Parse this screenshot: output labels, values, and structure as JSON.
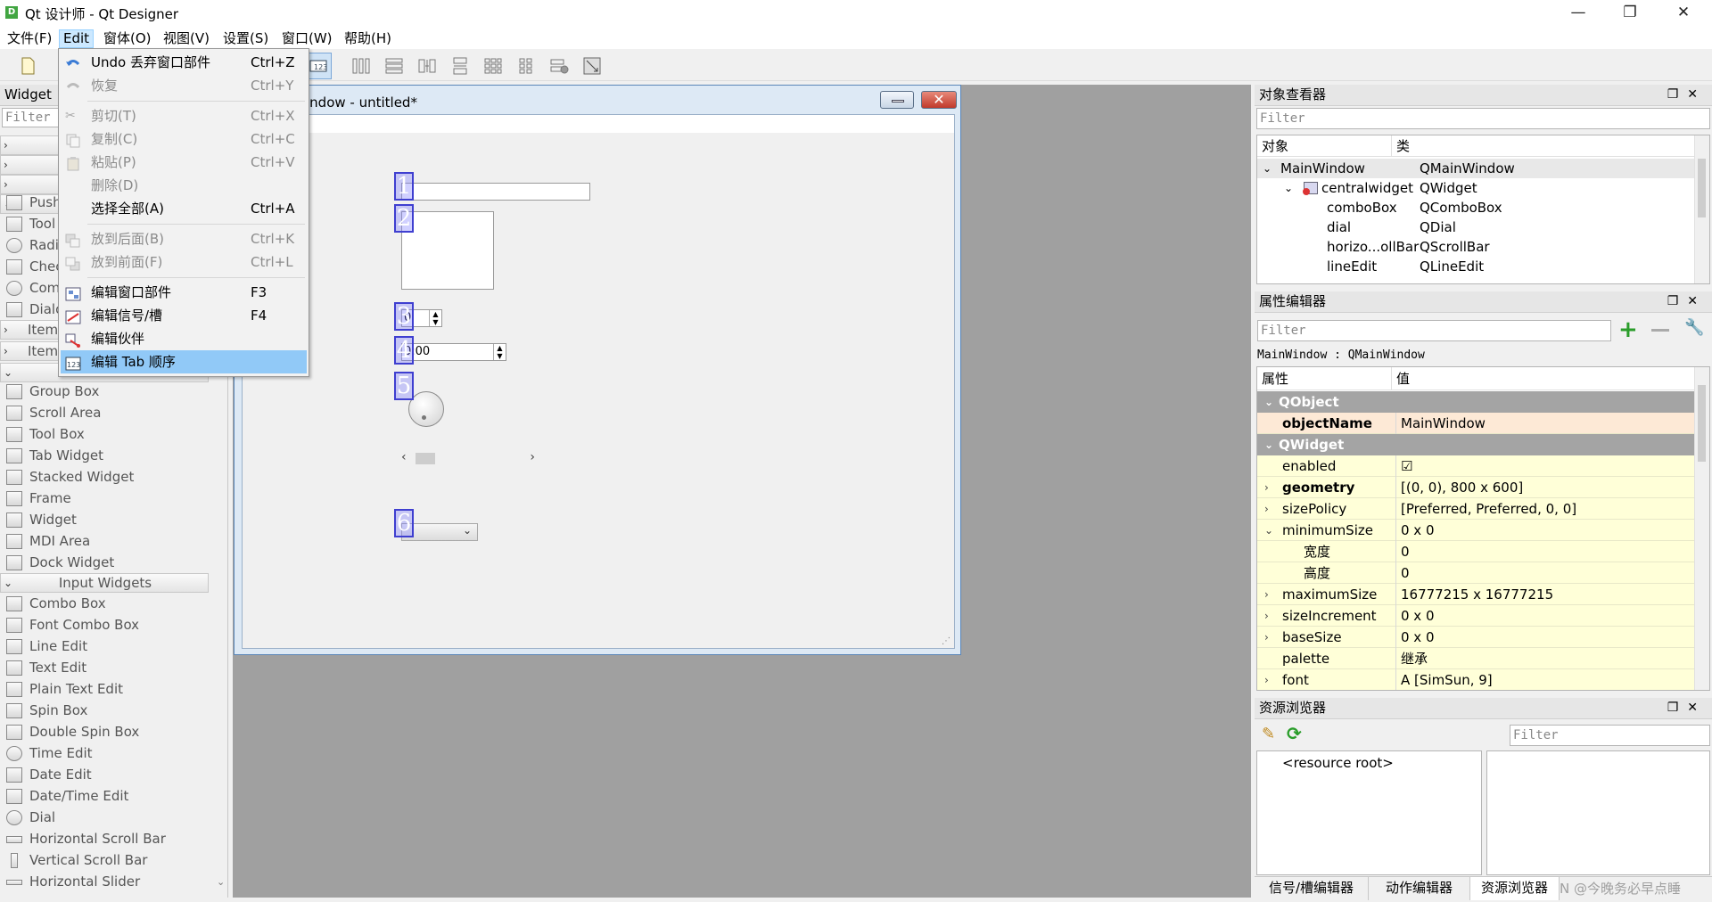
{
  "window": {
    "title": "Qt 设计师 - Qt Designer",
    "icon_letter": "D",
    "min_glyph": "—",
    "max_glyph": "❐",
    "close_glyph": "✕"
  },
  "menubar": [
    "文件(F)",
    "Edit",
    "窗体(O)",
    "视图(V)",
    "设置(S)",
    "窗口(W)",
    "帮助(H)"
  ],
  "edit_menu": [
    {
      "label": "Undo 丢弃窗口部件",
      "key": "Ctrl+Z",
      "disabled": false,
      "icon": "undo-icon"
    },
    {
      "label": "恢复",
      "key": "Ctrl+Y",
      "disabled": true,
      "icon": "redo-icon"
    },
    {
      "label": "剪切(T)",
      "key": "Ctrl+X",
      "disabled": true,
      "icon": "cut-icon"
    },
    {
      "label": "复制(C)",
      "key": "Ctrl+C",
      "disabled": true,
      "icon": "copy-icon"
    },
    {
      "label": "粘贴(P)",
      "key": "Ctrl+V",
      "disabled": true,
      "icon": "paste-icon"
    },
    {
      "label": "删除(D)",
      "key": "",
      "disabled": true,
      "icon": ""
    },
    {
      "label": "选择全部(A)",
      "key": "Ctrl+A",
      "disabled": false,
      "icon": ""
    },
    {
      "label": "放到后面(B)",
      "key": "Ctrl+K",
      "disabled": true,
      "icon": "send-back-icon"
    },
    {
      "label": "放到前面(F)",
      "key": "Ctrl+L",
      "disabled": true,
      "icon": "bring-front-icon"
    },
    {
      "label": "编辑窗口部件",
      "key": "F3",
      "disabled": false,
      "icon": "edit-widgets-icon"
    },
    {
      "label": "编辑信号/槽",
      "key": "F4",
      "disabled": false,
      "icon": "edit-signals-icon"
    },
    {
      "label": "编辑伙伴",
      "key": "",
      "disabled": false,
      "icon": "edit-buddies-icon"
    },
    {
      "label": "编辑 Tab 顺序",
      "key": "",
      "disabled": false,
      "icon": "edit-tab-order-icon"
    }
  ],
  "widget_box": {
    "title": "Widget",
    "filter_placeholder": "Filter",
    "partial_items": [
      "Push",
      "Tool",
      "Radi",
      "Chec",
      "Com",
      "Dialo",
      "Item",
      "Item"
    ],
    "containers": [
      "Group Box",
      "Scroll Area",
      "Tool Box",
      "Tab Widget",
      "Stacked Widget",
      "Frame",
      "Widget",
      "MDI Area",
      "Dock Widget"
    ],
    "input_category": "Input Widgets",
    "inputs": [
      "Combo Box",
      "Font Combo Box",
      "Line Edit",
      "Text Edit",
      "Plain Text Edit",
      "Spin Box",
      "Double Spin Box",
      "Time Edit",
      "Date Edit",
      "Date/Time Edit",
      "Dial",
      "Horizontal Scroll Bar",
      "Vertical Scroll Bar",
      "Horizontal Slider"
    ]
  },
  "form": {
    "title": "indow - untitled*",
    "badges": [
      "1",
      "2",
      "3",
      "4",
      "5",
      "6"
    ],
    "spin_value": "0",
    "time_value": "0:00"
  },
  "object_inspector": {
    "title": "对象查看器",
    "filter_placeholder": "Filter",
    "col_object": "对象",
    "col_class": "类",
    "rows": [
      {
        "name": "MainWindow",
        "cls": "QMainWindow",
        "level": 0
      },
      {
        "name": "centralwidget",
        "cls": "QWidget",
        "level": 1
      },
      {
        "name": "comboBox",
        "cls": "QComboBox",
        "level": 2
      },
      {
        "name": "dial",
        "cls": "QDial",
        "level": 2
      },
      {
        "name": "horizo...ollBar",
        "cls": "QScrollBar",
        "level": 2
      },
      {
        "name": "lineEdit",
        "cls": "QLineEdit",
        "level": 2
      }
    ]
  },
  "property_editor": {
    "title": "属性编辑器",
    "filter_placeholder": "Filter",
    "context": "MainWindow : QMainWindow",
    "col_prop": "属性",
    "col_value": "值",
    "group_qobject": "QObject",
    "group_qwidget": "QWidget",
    "object_name_label": "objectName",
    "object_name_value": "MainWindow",
    "rows": [
      {
        "name": "enabled",
        "value": "☑",
        "bold": false,
        "chev": ""
      },
      {
        "name": "geometry",
        "value": "[(0, 0), 800 x 600]",
        "bold": true,
        "chev": "›"
      },
      {
        "name": "sizePolicy",
        "value": "[Preferred, Preferred, 0, 0]",
        "bold": false,
        "chev": "›"
      },
      {
        "name": "minimumSize",
        "value": "0 x 0",
        "bold": false,
        "chev": "⌄"
      },
      {
        "name": "宽度",
        "value": "0",
        "bold": false,
        "chev": "",
        "indent": true
      },
      {
        "name": "高度",
        "value": "0",
        "bold": false,
        "chev": "",
        "indent": true
      },
      {
        "name": "maximumSize",
        "value": "16777215 x 16777215",
        "bold": false,
        "chev": "›"
      },
      {
        "name": "sizeIncrement",
        "value": "0 x 0",
        "bold": false,
        "chev": "›"
      },
      {
        "name": "baseSize",
        "value": "0 x 0",
        "bold": false,
        "chev": "›"
      },
      {
        "name": "palette",
        "value": "继承",
        "bold": false,
        "chev": ""
      },
      {
        "name": "font",
        "value": "A  [SimSun, 9]",
        "bold": false,
        "chev": "›"
      }
    ]
  },
  "resource_browser": {
    "title": "资源浏览器",
    "filter_placeholder": "Filter",
    "root": "<resource root>"
  },
  "bottom_tabs": [
    "信号/槽编辑器",
    "动作编辑器",
    "资源浏览器"
  ],
  "watermark": "N @今晚务必早点睡",
  "colors": {
    "accent": "#91c9f7",
    "prop_yellow": "#ffffd8",
    "prop_selected": "#fde9d6",
    "group_gray": "#a4a4a4",
    "tab_badge": "#3f3fd0"
  }
}
